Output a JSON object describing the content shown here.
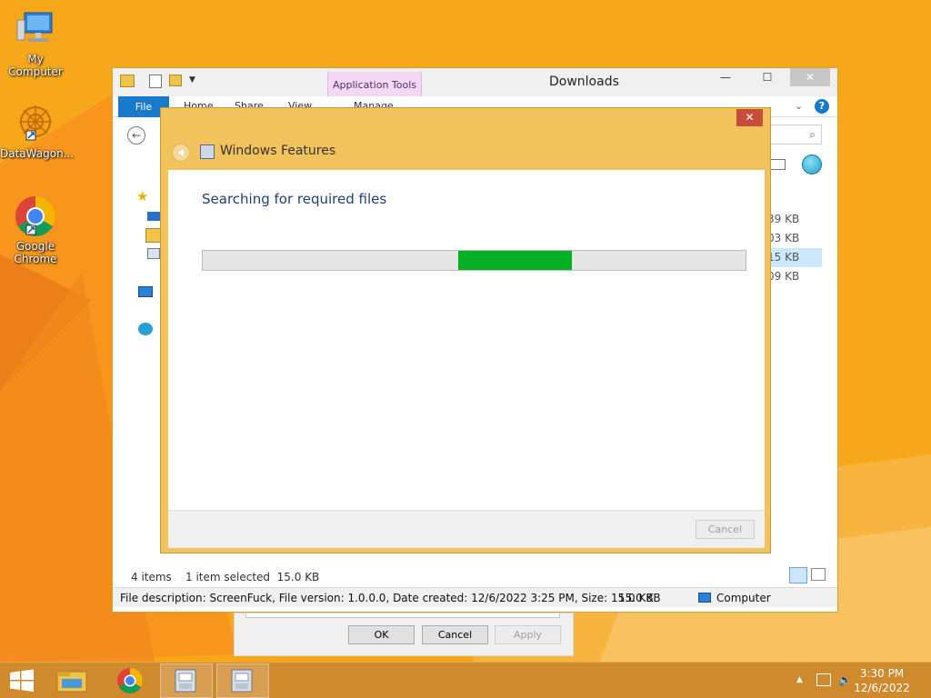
{
  "desktop": {
    "icons": [
      {
        "label": "My Computer",
        "icon": "computer-icon"
      },
      {
        "label": "DataWagon...",
        "icon": "datawagon-icon"
      },
      {
        "label": "Google Chrome",
        "icon": "chrome-icon"
      }
    ]
  },
  "explorer": {
    "title": "Downloads",
    "file_tab": "File",
    "tabs": [
      "Home",
      "Share",
      "View"
    ],
    "context_tab_group": "Application Tools",
    "context_tab": "Manage",
    "sizes": [
      "39 KB",
      "03 KB",
      "15 KB",
      "09 KB"
    ],
    "status": {
      "items": "4 items",
      "selected": "1 item selected  15.0 KB",
      "description": "File description: ScreenFuck, File version: 1.0.0.0, Date created: 12/6/2022 3:25 PM, Size: 15.0 KB",
      "size": "15.0 KB",
      "location": "Computer"
    }
  },
  "props_dialog": {
    "ok": "OK",
    "cancel": "Cancel",
    "apply": "Apply"
  },
  "windows_features": {
    "title": "Windows Features",
    "heading": "Searching for required files",
    "progress": {
      "indeterminate": true,
      "segment_start": 0.47,
      "segment_end": 0.68,
      "color": "#06b025"
    },
    "cancel": "Cancel"
  },
  "taskbar": {
    "time": "3:30 PM",
    "date": "12/6/2022"
  }
}
